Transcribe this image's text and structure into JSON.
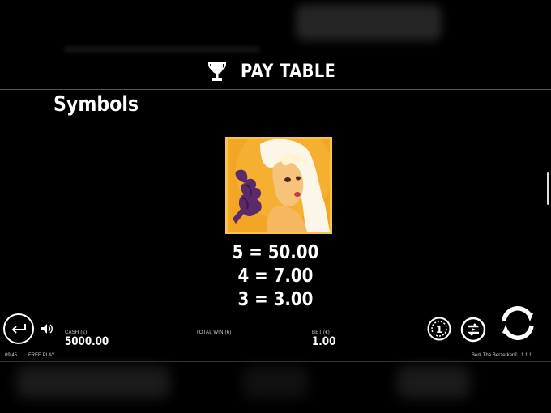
{
  "header": {
    "title": "PAY TABLE",
    "icon": "trophy-icon"
  },
  "section": {
    "title": "Symbols"
  },
  "symbol": {
    "name": "woman-symbol-icon",
    "payouts": [
      "5 = 50.00",
      "4 = 7.00",
      "3 = 3.00"
    ]
  },
  "footer": {
    "cash_label": "CASH (€)",
    "cash_value": "5000.00",
    "total_win_label": "TOTAL WIN (€)",
    "bet_label": "BET (€)",
    "bet_value": "1.00",
    "time": "09:45",
    "mode": "FREE PLAY",
    "game_name": "Berk The Berzerker®",
    "version": "1.1.1"
  },
  "colors": {
    "background": "#000000",
    "symbol_frame": "#e8a020",
    "text": "#ffffff"
  }
}
